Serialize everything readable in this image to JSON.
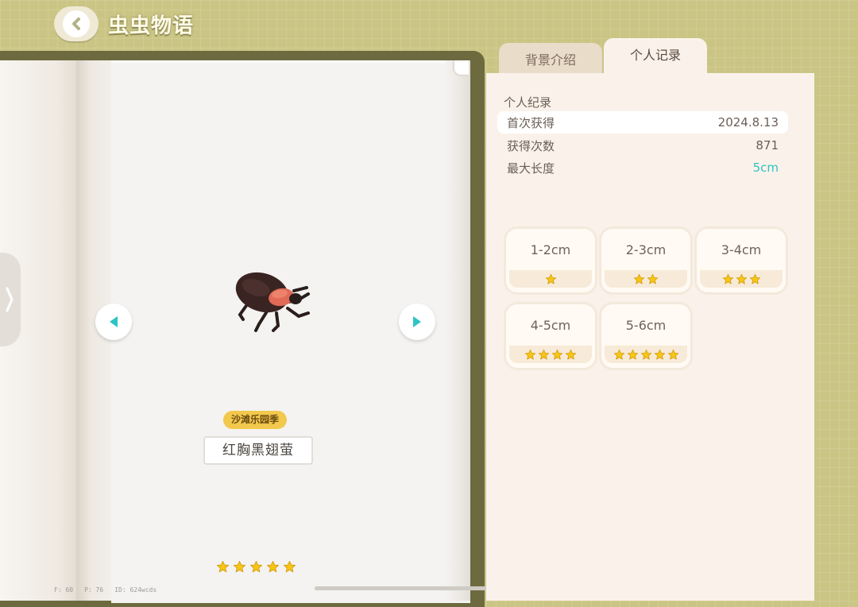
{
  "header": {
    "title": "虫虫物语"
  },
  "book": {
    "season": "沙滩乐园季",
    "bug_name": "红胸黑翅萤",
    "rarity": 5
  },
  "debug": {
    "fps": "F: 60",
    "ping": "P: 76",
    "id": "ID: 624wcds"
  },
  "tabs": [
    {
      "label": "背景介绍",
      "active": false
    },
    {
      "label": "个人记录",
      "active": true
    }
  ],
  "records": {
    "section_title": "个人纪录",
    "rows": [
      {
        "label": "首次获得",
        "value": "2024.8.13"
      },
      {
        "label": "获得次数",
        "value": "871"
      },
      {
        "label": "最大长度",
        "value": "5cm"
      }
    ]
  },
  "size_grades": [
    {
      "range": "1-2cm",
      "stars": 1
    },
    {
      "range": "2-3cm",
      "stars": 2
    },
    {
      "range": "3-4cm",
      "stars": 3
    },
    {
      "range": "4-5cm",
      "stars": 4
    },
    {
      "range": "5-6cm",
      "stars": 5
    }
  ],
  "colors": {
    "background": "#cbc585",
    "panel": "#faf2ea",
    "accent_cyan": "#2ec4c4",
    "star": "#f5c518",
    "badge": "#f2c94c"
  }
}
